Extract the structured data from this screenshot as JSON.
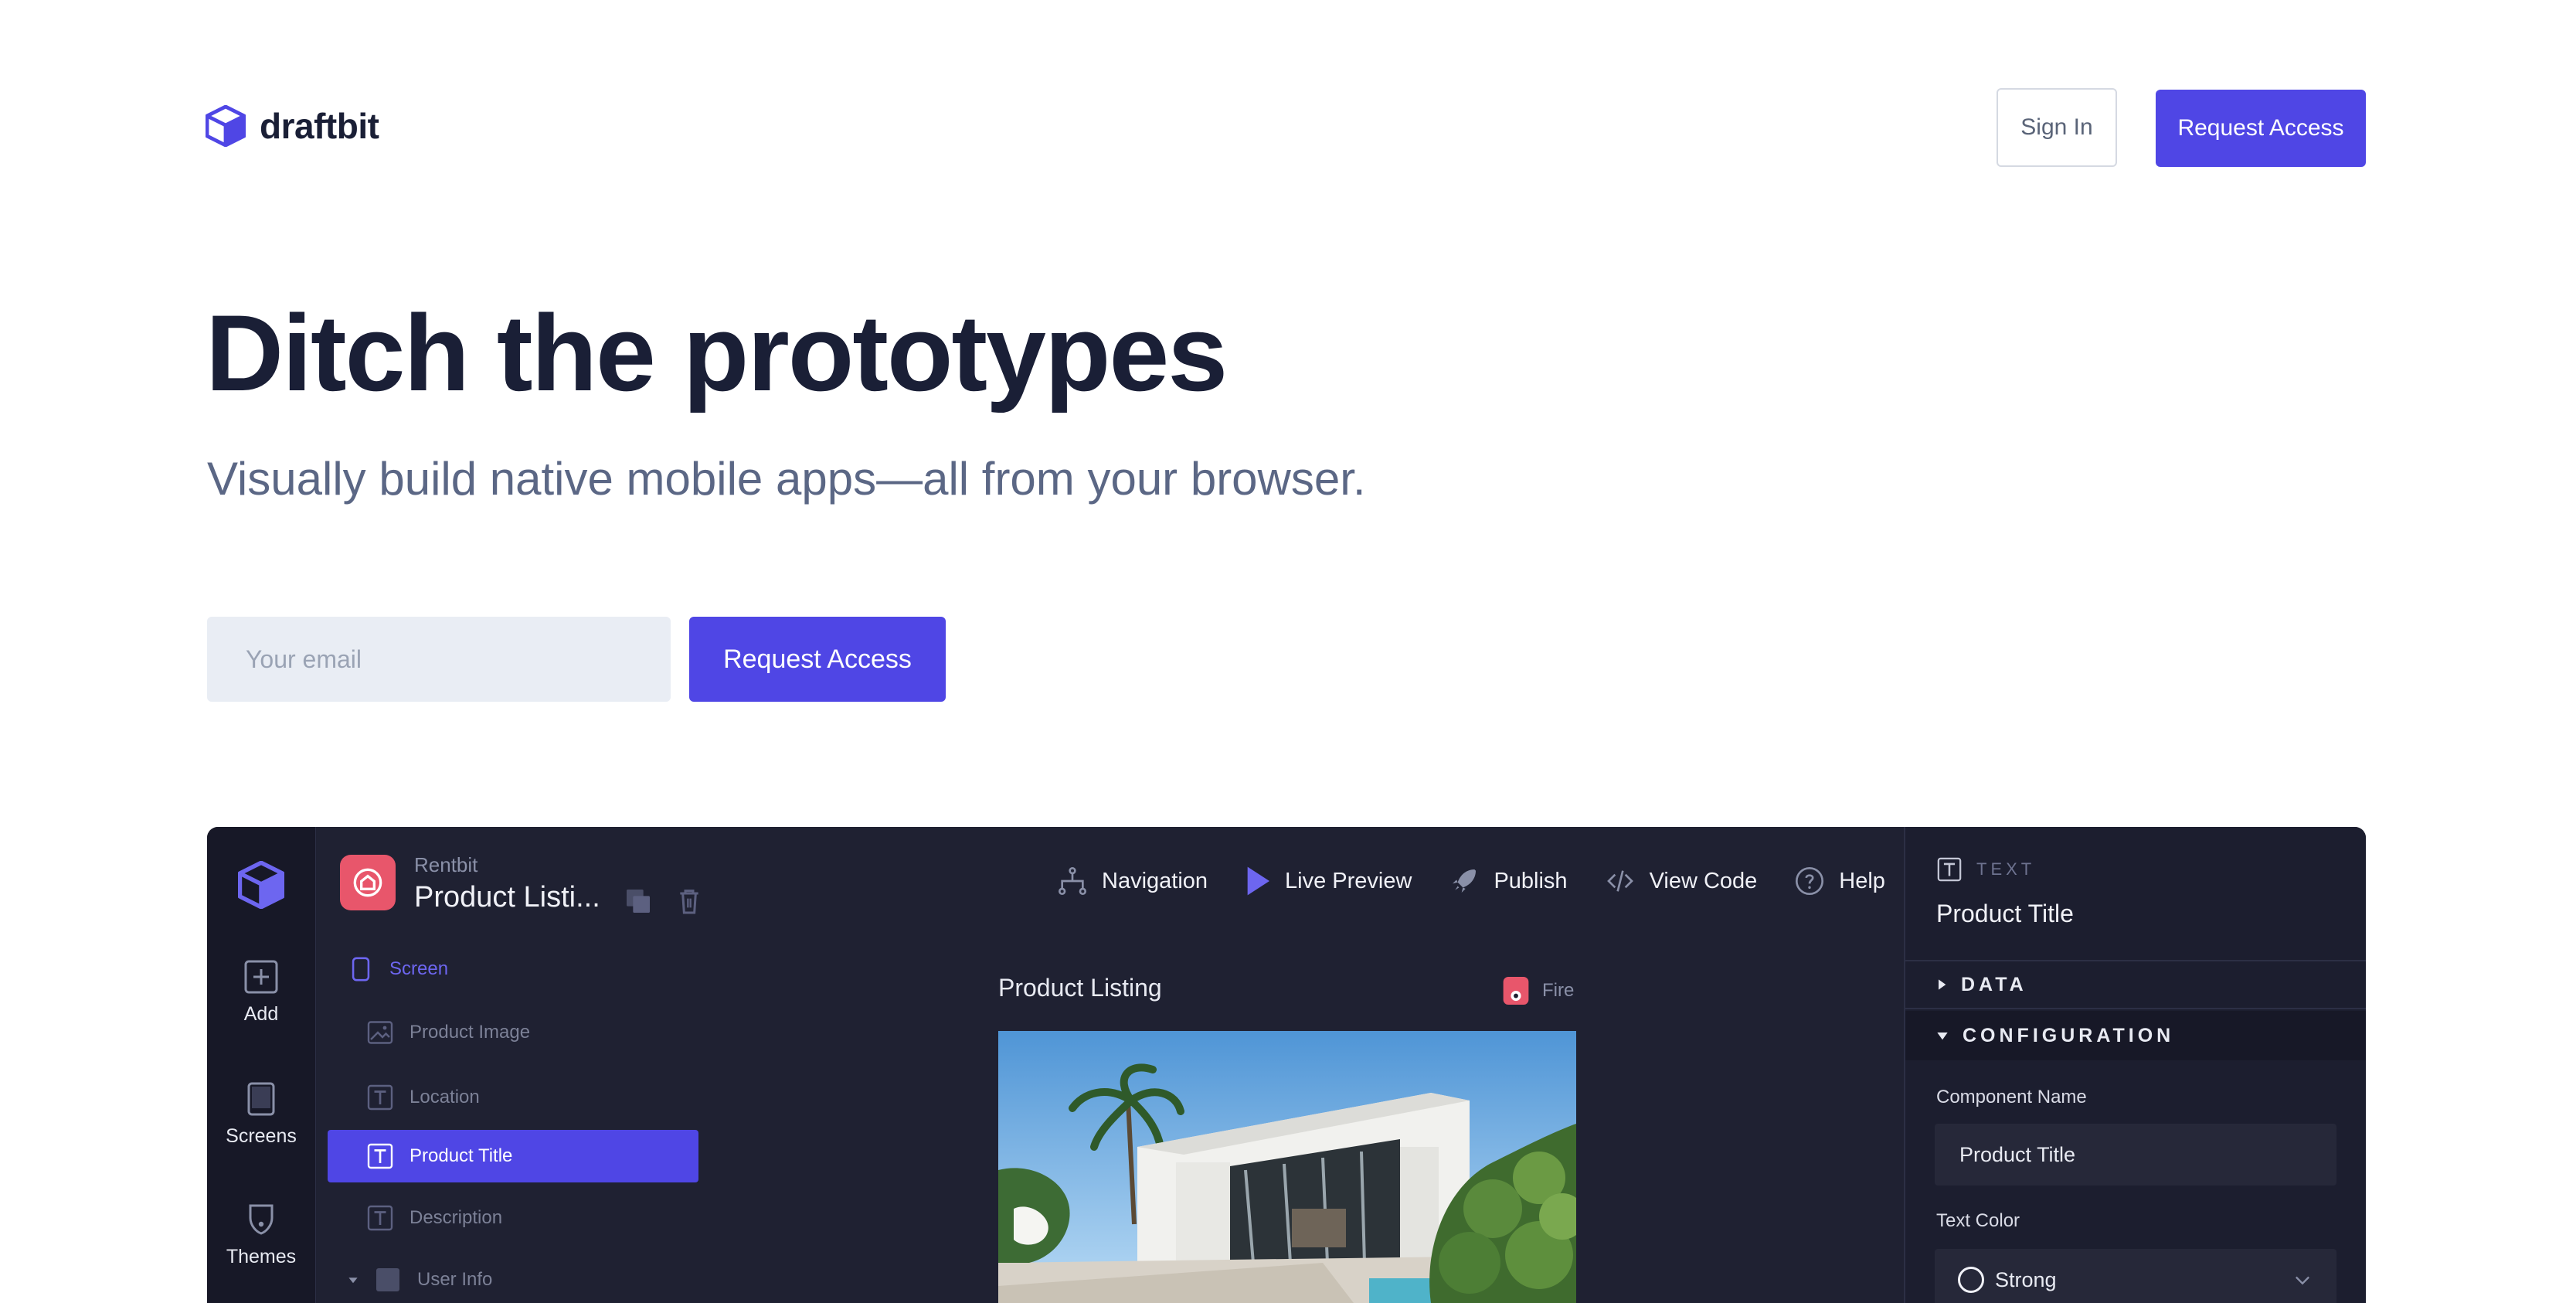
{
  "header": {
    "logo_text": "draftbit",
    "sign_in_label": "Sign In",
    "request_access_label": "Request Access"
  },
  "hero": {
    "headline": "Ditch the prototypes",
    "subheadline": "Visually build native mobile apps—all from your browser.",
    "email_placeholder": "Your email",
    "request_access_label": "Request Access"
  },
  "colors": {
    "brand": "#4f46e5",
    "app_bg": "#1f2132",
    "rail_bg": "#171827",
    "heading": "#1a1f36",
    "subtext": "#5b6785"
  },
  "app": {
    "rail": [
      {
        "label": "Add",
        "icon": "plus-square-icon"
      },
      {
        "label": "Screens",
        "icon": "tablet-icon"
      },
      {
        "label": "Themes",
        "icon": "theme-icon"
      }
    ],
    "project": {
      "name": "Rentbit",
      "screen_title": "Product Listi..."
    },
    "tree": {
      "screen": "Screen",
      "items": [
        "Product Image",
        "Location",
        "Product Title",
        "Description",
        "User Info"
      ],
      "selected": "Product Title"
    },
    "toolbar": {
      "navigation": "Navigation",
      "live_preview": "Live Preview",
      "publish": "Publish",
      "view_code": "View Code",
      "help": "Help"
    },
    "canvas": {
      "screen_name": "Product Listing",
      "device_label": "Fire"
    },
    "props": {
      "type_label": "TEXT",
      "title": "Product Title",
      "data_section": "DATA",
      "config_section": "CONFIGURATION",
      "component_name_label": "Component Name",
      "component_name_value": "Product Title",
      "text_color_label": "Text Color",
      "text_color_value": "Strong"
    }
  }
}
